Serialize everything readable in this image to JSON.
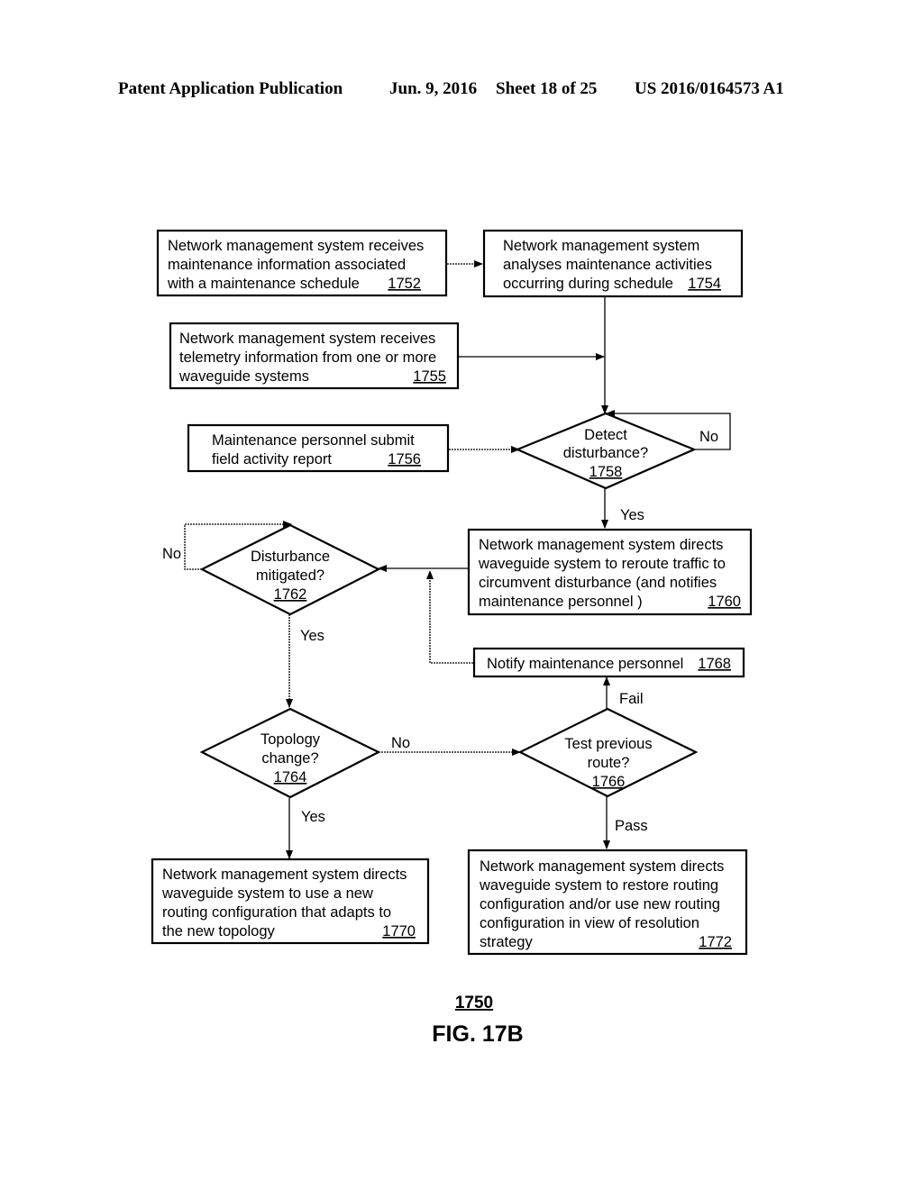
{
  "header": {
    "publication": "Patent Application Publication",
    "date": "Jun. 9, 2016",
    "sheet": "Sheet 18 of 25",
    "number": "US 2016/0164573 A1"
  },
  "figure": {
    "ref": "1750",
    "title": "FIG. 17B"
  },
  "nodes": {
    "n1752": {
      "lines": [
        "Network management system receives",
        "maintenance information associated",
        "with a maintenance schedule"
      ],
      "ref": "1752"
    },
    "n1754": {
      "lines": [
        "Network management system",
        "analyses maintenance activities",
        "occurring during schedule"
      ],
      "ref": "1754"
    },
    "n1755": {
      "lines": [
        "Network management system receives",
        "telemetry information from one or more",
        "waveguide systems"
      ],
      "ref": "1755"
    },
    "n1756": {
      "lines": [
        "Maintenance personnel submit",
        "field activity report"
      ],
      "ref": "1756"
    },
    "n1758": {
      "lines": [
        "Detect",
        "disturbance?"
      ],
      "ref": "1758"
    },
    "n1760": {
      "lines": [
        "Network management system directs",
        "waveguide system to reroute traffic  to",
        "circumvent disturbance  (and notifies",
        "maintenance personnel )"
      ],
      "ref": "1760"
    },
    "n1762": {
      "lines": [
        "Disturbance",
        "mitigated?"
      ],
      "ref": "1762"
    },
    "n1764": {
      "lines": [
        "Topology",
        "change?"
      ],
      "ref": "1764"
    },
    "n1766": {
      "lines": [
        "Test previous",
        "route?"
      ],
      "ref": "1766"
    },
    "n1768": {
      "lines": [
        "Notify maintenance personnel"
      ],
      "ref": "1768"
    },
    "n1770": {
      "lines": [
        "Network management system directs",
        "waveguide system to use a new",
        "routing configuration that adapts to",
        "the new topology"
      ],
      "ref": "1770"
    },
    "n1772": {
      "lines": [
        "Network management system directs",
        "waveguide system to restore routing",
        "configuration and/or use new routing",
        "configuration in view of resolution",
        "strategy"
      ],
      "ref": "1772"
    }
  },
  "edge_labels": {
    "detect_no": "No",
    "detect_yes": "Yes",
    "mitigated_no": "No",
    "mitigated_yes": "Yes",
    "topology_no": "No",
    "topology_yes": "Yes",
    "test_fail": "Fail",
    "test_pass": "Pass"
  }
}
